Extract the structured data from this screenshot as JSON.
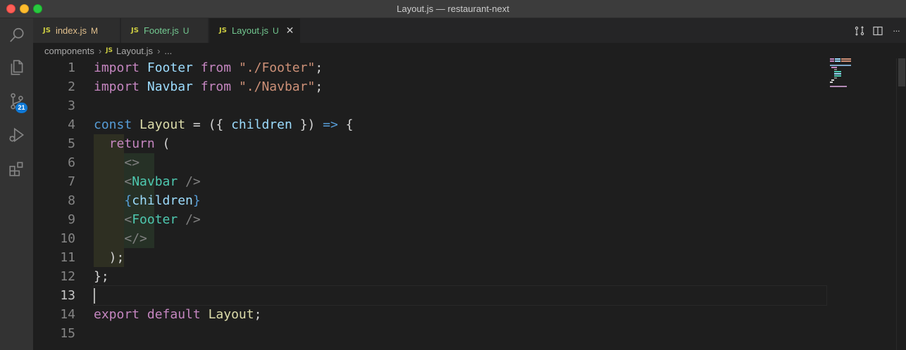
{
  "window": {
    "title": "Layout.js — restaurant-next"
  },
  "activity_bar": {
    "items": [
      {
        "icon": "search-icon"
      },
      {
        "icon": "explorer-icon"
      },
      {
        "icon": "source-control-icon",
        "badge": "21"
      },
      {
        "icon": "run-debug-icon"
      },
      {
        "icon": "extensions-icon"
      }
    ]
  },
  "tabs": [
    {
      "badge": "JS",
      "label": "index.js",
      "status": "M"
    },
    {
      "badge": "JS",
      "label": "Footer.js",
      "status": "U"
    },
    {
      "badge": "JS",
      "label": "Layout.js",
      "status": "U",
      "close": "✕"
    }
  ],
  "tab_actions": {
    "more": "···"
  },
  "breadcrumb": {
    "folder": "components",
    "file_badge": "JS",
    "file": "Layout.js",
    "tail": "..."
  },
  "editor": {
    "line_numbers": [
      "1",
      "2",
      "3",
      "4",
      "5",
      "6",
      "7",
      "8",
      "9",
      "10",
      "11",
      "12",
      "13",
      "14",
      "15"
    ],
    "active_line": 13
  },
  "colors": {
    "keyword": "#c586c0",
    "storage": "#569cd6",
    "string": "#ce9178",
    "component": "#4ec9b0",
    "function": "#dcdcaa",
    "variable": "#9cdcfe",
    "modified": "#e2c08d",
    "untracked": "#73c991",
    "badge": "#0e78d5"
  }
}
